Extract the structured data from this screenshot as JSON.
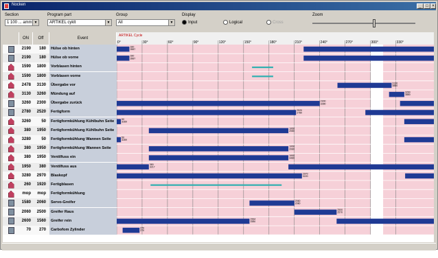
{
  "window": {
    "title": "Nocken",
    "colors": {
      "title_start": "#0a246a",
      "title_end": "#3a6ea5"
    }
  },
  "toolbar": {
    "section_label": "Section",
    "section_value": "1 100 ... amm",
    "program_label": "Program part",
    "program_value": "ARTIKEL cyklt",
    "group_label": "Group",
    "group_value": "All",
    "display_label": "Display",
    "display_options": [
      {
        "label": "Input",
        "selected": true,
        "enabled": true
      },
      {
        "label": "Logical",
        "selected": false,
        "enabled": true
      },
      {
        "label": "Cross",
        "selected": false,
        "enabled": false
      }
    ],
    "zoom_label": "Zoom",
    "zoom_fraction": 0.6
  },
  "table": {
    "col_on": "ON",
    "col_off": "Off",
    "col_event": "Event",
    "cycle_label": "ARTIKEL Cycle",
    "angle_ticks": [
      "0°",
      "30°",
      "60°",
      "90°",
      "120°",
      "150°",
      "180°",
      "210°",
      "240°",
      "270°",
      "300°",
      "330°"
    ],
    "angle_max": 375
  },
  "colors": {
    "bar": "#1f3a94",
    "teal": "#2fb0b0",
    "grid_bg": "#f6d0d8",
    "highlight": "#ffffff",
    "name_bg": "#c8cfdb"
  },
  "rows": [
    {
      "icon": "plain",
      "on": "2190",
      "off": "180",
      "name": "Hülse ob hinten",
      "bars": [
        {
          "s": 0,
          "e": 15,
          "l": "180 | 2887"
        },
        {
          "s": 221,
          "e": 375,
          "l": ""
        }
      ]
    },
    {
      "icon": "plain",
      "on": "2190",
      "off": "180",
      "name": "Hülse ob vorne",
      "bars": [
        {
          "s": 0,
          "e": 15,
          "l": "180 | 2887"
        },
        {
          "s": 221,
          "e": 375,
          "l": ""
        }
      ]
    },
    {
      "icon": "house",
      "on": "1590",
      "off": "1800",
      "name": "Vorblasen hinten",
      "bars": [
        {
          "s": 160,
          "e": 185,
          "l": "",
          "t": "teal"
        }
      ]
    },
    {
      "icon": "house",
      "on": "1590",
      "off": "1800",
      "name": "Vorblasen vorne",
      "bars": [
        {
          "s": 160,
          "e": 185,
          "l": "",
          "t": "teal"
        }
      ]
    },
    {
      "icon": "house",
      "on": "2478",
      "off": "3130",
      "name": "Übergabe vor",
      "bars": [
        {
          "s": 261,
          "e": 325,
          "l": "3130 | 3880"
        }
      ]
    },
    {
      "icon": "house",
      "on": "3130",
      "off": "3260",
      "name": "Mündung auf",
      "bars": [
        {
          "s": 322,
          "e": 340,
          "l": "3260 | 3880"
        }
      ]
    },
    {
      "icon": "plain",
      "on": "3260",
      "off": "2300",
      "name": "Übergabe zurück",
      "bars": [
        {
          "s": 0,
          "e": 240,
          "l": "2300 | 3280"
        },
        {
          "s": 335,
          "e": 375,
          "l": ""
        }
      ]
    },
    {
      "icon": "plain",
      "on": "2780",
      "off": "2520",
      "name": "Fertigform",
      "bars": [
        {
          "s": 0,
          "e": 212,
          "l": "2520 | 2780"
        },
        {
          "s": 294,
          "e": 375,
          "l": ""
        }
      ]
    },
    {
      "icon": "house",
      "on": "3260",
      "off": "50",
      "name": "Fertigformkühlung Kühlbuhn Seite",
      "bars": [
        {
          "s": 0,
          "e": 5,
          "l": "50 | 3289"
        },
        {
          "s": 340,
          "e": 375,
          "l": ""
        }
      ]
    },
    {
      "icon": "house",
      "on": "380",
      "off": "1950",
      "name": "Fertigformkühlung Kühlbuhn Seite",
      "bars": [
        {
          "s": 38,
          "e": 203,
          "l": "1950 | 2080"
        }
      ]
    },
    {
      "icon": "house",
      "on": "3280",
      "off": "50",
      "name": "Fertigformkühlung Wannen Seite",
      "bars": [
        {
          "s": 0,
          "e": 5,
          "l": "50 | 3289"
        },
        {
          "s": 340,
          "e": 375,
          "l": ""
        }
      ]
    },
    {
      "icon": "house",
      "on": "380",
      "off": "1950",
      "name": "Fertigformkühlung Wannen Seite",
      "bars": [
        {
          "s": 38,
          "e": 203,
          "l": "1950 | 2080"
        }
      ]
    },
    {
      "icon": "house",
      "on": "380",
      "off": "1950",
      "name": "Ventilfuss ein",
      "bars": [
        {
          "s": 38,
          "e": 203,
          "l": "1950 | 3480"
        }
      ]
    },
    {
      "icon": "house",
      "on": "1950",
      "off": "380",
      "name": "Ventilfuss aus",
      "bars": [
        {
          "s": 0,
          "e": 38,
          "l": "380 | 3217"
        },
        {
          "s": 203,
          "e": 375,
          "l": ""
        }
      ]
    },
    {
      "icon": "house",
      "on": "3280",
      "off": "2970",
      "name": "Blaskopf",
      "bars": [
        {
          "s": 0,
          "e": 219,
          "l": "2970 | 3220"
        },
        {
          "s": 341,
          "e": 375,
          "l": ""
        }
      ]
    },
    {
      "icon": "house",
      "on": "260",
      "off": "1920",
      "name": "Fertigblasen",
      "bars": [
        {
          "s": 40,
          "e": 195,
          "l": "",
          "t": "teal"
        }
      ]
    },
    {
      "icon": "house",
      "on": "mop",
      "off": "mop",
      "name": "Fertigformkühlung",
      "bars": []
    },
    {
      "icon": "plain",
      "on": "1580",
      "off": "2060",
      "name": "Servo-Greifer",
      "bars": [
        {
          "s": 157,
          "e": 210,
          "l": "2060 | 2080"
        }
      ]
    },
    {
      "icon": "plain",
      "on": "2060",
      "off": "2500",
      "name": "Greifer Raus",
      "bars": [
        {
          "s": 210,
          "e": 260,
          "l": "2500 | 2570"
        }
      ]
    },
    {
      "icon": "plain",
      "on": "2600",
      "off": "1560",
      "name": "Greifer rein",
      "bars": [
        {
          "s": 0,
          "e": 157,
          "l": "1564 | 1580"
        },
        {
          "s": 260,
          "e": 375,
          "l": ""
        }
      ]
    },
    {
      "icon": "plain",
      "on": "70",
      "off": "270",
      "name": "Carbofom Zylinder",
      "bars": [
        {
          "s": 7,
          "e": 27,
          "l": "270 | 270"
        }
      ]
    }
  ]
}
